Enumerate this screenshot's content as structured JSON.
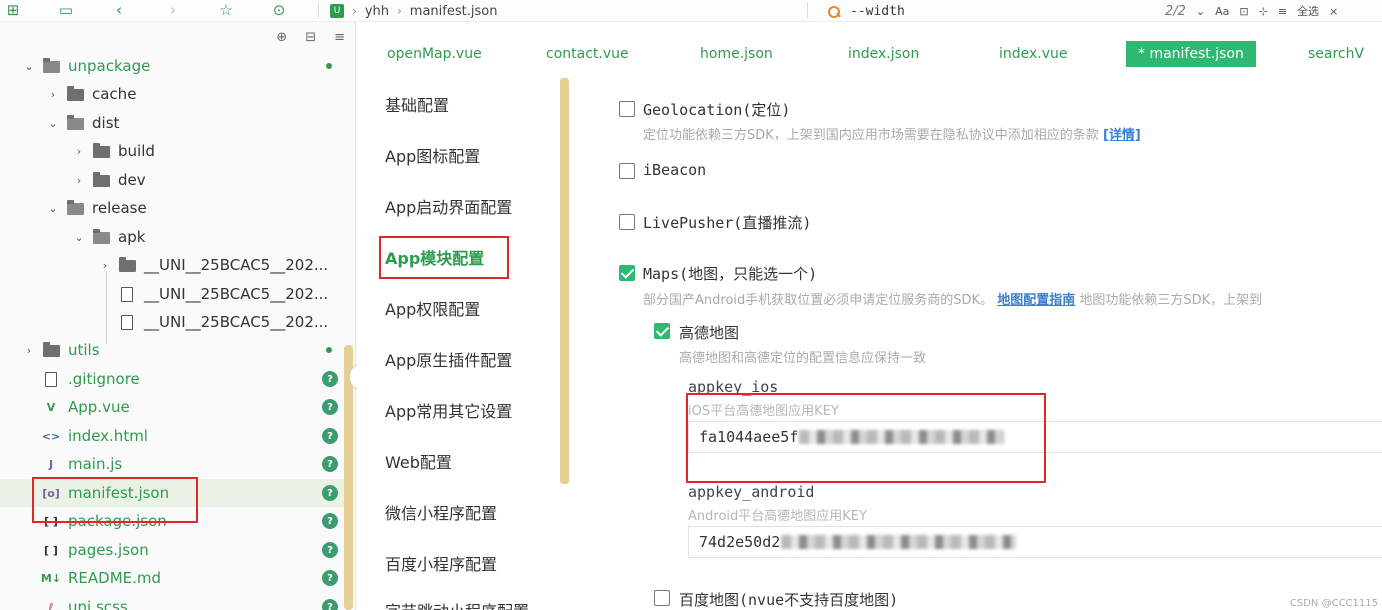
{
  "toolbar": {
    "breadcrumb": {
      "project": "yhh",
      "file": "manifest.json"
    },
    "search": {
      "value": "--width",
      "match_count": "2/2"
    },
    "buttons": {
      "case": "Aa",
      "select_all": "全选"
    }
  },
  "explorer": {
    "tree": [
      {
        "label": "unpackage",
        "kind": "folder",
        "open": true,
        "status": "dot"
      },
      {
        "label": "cache",
        "kind": "folder"
      },
      {
        "label": "dist",
        "kind": "folder",
        "open": true
      },
      {
        "label": "build",
        "kind": "folder"
      },
      {
        "label": "dev",
        "kind": "folder"
      },
      {
        "label": "release",
        "kind": "folder",
        "open": true
      },
      {
        "label": "apk",
        "kind": "folder",
        "open": true
      },
      {
        "label": "__UNI__25BCAC5__202...",
        "kind": "folder"
      },
      {
        "label": "__UNI__25BCAC5__202...",
        "kind": "file"
      },
      {
        "label": "__UNI__25BCAC5__202...",
        "kind": "file"
      },
      {
        "label": "utils",
        "kind": "folder",
        "status": "dot"
      },
      {
        "label": ".gitignore",
        "kind": "file",
        "status": "?"
      },
      {
        "label": "App.vue",
        "kind": "vue",
        "status": "?"
      },
      {
        "label": "index.html",
        "kind": "html",
        "status": "?"
      },
      {
        "label": "main.js",
        "kind": "js",
        "status": "?"
      },
      {
        "label": "manifest.json",
        "kind": "manifest",
        "status": "?"
      },
      {
        "label": "package.json",
        "kind": "json",
        "status": "?"
      },
      {
        "label": "pages.json",
        "kind": "json",
        "status": "?"
      },
      {
        "label": "README.md",
        "kind": "md",
        "status": "?"
      },
      {
        "label": "uni.scss",
        "kind": "scss",
        "status": "?"
      }
    ]
  },
  "tabs": [
    {
      "label": "openMap.vue"
    },
    {
      "label": "contact.vue"
    },
    {
      "label": "home.json"
    },
    {
      "label": "index.json"
    },
    {
      "label": "index.vue"
    },
    {
      "label": "* manifest.json",
      "active": true
    },
    {
      "label": "searchV"
    }
  ],
  "settings_nav": [
    {
      "label": "基础配置"
    },
    {
      "label": "App图标配置"
    },
    {
      "label": "App启动界面配置"
    },
    {
      "label": "App模块配置",
      "active": true
    },
    {
      "label": "App权限配置"
    },
    {
      "label": "App原生插件配置"
    },
    {
      "label": "App常用其它设置"
    },
    {
      "label": "Web配置"
    },
    {
      "label": "微信小程序配置"
    },
    {
      "label": "百度小程序配置"
    },
    {
      "label": "字节跳动小程序配置"
    }
  ],
  "modules": {
    "geolocation": {
      "title": "Geolocation(定位)",
      "checked": false,
      "desc": "定位功能依赖三方SDK，上架到国内应用市场需要在隐私协议中添加相应的条款",
      "link": "[详情]"
    },
    "ibeacon": {
      "title": "iBeacon",
      "checked": false
    },
    "livepusher": {
      "title": "LivePusher(直播推流)",
      "checked": false
    },
    "maps": {
      "title": "Maps(地图，只能选一个)",
      "checked": true,
      "desc": "部分国产Android手机获取位置必须申请定位服务商的SDK。",
      "link": "地图配置指南",
      "desc_tail": "地图功能依赖三方SDK，上架到"
    },
    "amap": {
      "title": "高德地图",
      "checked": true,
      "desc": "高德地图和高德定位的配置信息应保持一致",
      "ios_label": "appkey_ios",
      "ios_hint": "iOS平台高德地图应用KEY",
      "ios_value": "fa1044aee5f",
      "android_label": "appkey_android",
      "android_hint": "Android平台高德地图应用KEY",
      "android_value": "74d2e50d2"
    },
    "baidu": {
      "title": "百度地图(nvue不支持百度地图)",
      "checked": false
    }
  },
  "watermark": "CSDN @CCC1115"
}
